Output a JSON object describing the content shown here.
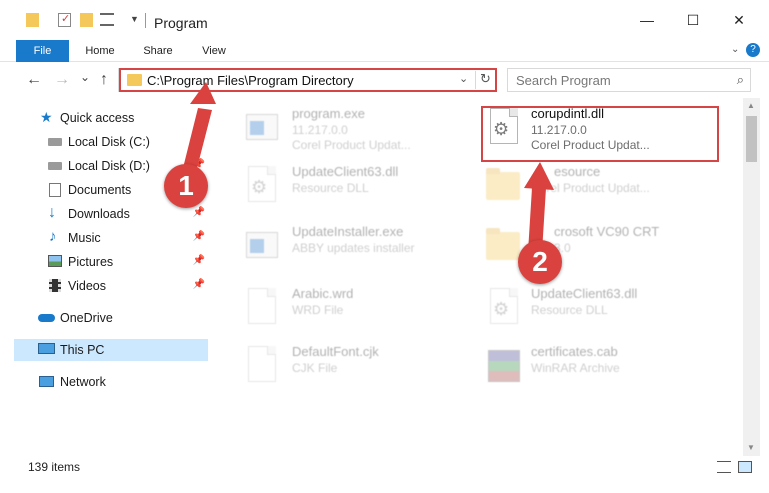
{
  "window": {
    "title": "Program",
    "minimize_glyph": "—",
    "maximize_glyph": "☐",
    "close_glyph": "✕"
  },
  "ribbon": {
    "tabs": [
      "File",
      "Home",
      "Share",
      "View"
    ],
    "help_glyph": "?"
  },
  "address": {
    "path": "C:\\Program Files\\Program Directory",
    "back_glyph": "←",
    "forward_glyph": "→",
    "recent_glyph": "⌄",
    "up_glyph": "↑",
    "dropdown_glyph": "⌄",
    "refresh_glyph": "↻"
  },
  "search": {
    "placeholder": "Search Program",
    "icon_glyph": "⌕"
  },
  "sidebar": {
    "items": [
      {
        "label": "Quick access",
        "icon": "star-icon"
      },
      {
        "label": "Local Disk (C:)",
        "icon": "drive-icon"
      },
      {
        "label": "Local Disk (D:)",
        "icon": "drive-icon"
      },
      {
        "label": "Documents",
        "icon": "documents-icon"
      },
      {
        "label": "Downloads",
        "icon": "download-icon"
      },
      {
        "label": "Music",
        "icon": "music-icon"
      },
      {
        "label": "Pictures",
        "icon": "pictures-icon"
      },
      {
        "label": "Videos",
        "icon": "videos-icon"
      },
      {
        "label": "OneDrive",
        "icon": "cloud-icon"
      },
      {
        "label": "This PC",
        "icon": "computer-icon"
      },
      {
        "label": "Network",
        "icon": "network-icon"
      }
    ]
  },
  "files": [
    {
      "name": "program.exe",
      "line1": "11.217.0.0",
      "line2": "Corel Product Updat...",
      "icon": "exe-icon"
    },
    {
      "name": "corupdintl.dll",
      "line1": "11.217.0.0",
      "line2": "Corel Product Updat...",
      "icon": "dll-icon"
    },
    {
      "name": "UpdateClient63.dll",
      "line1": "Resource DLL",
      "line2": "",
      "icon": "dll-icon"
    },
    {
      "name": "esource",
      "line1": "Corel Product Updat...",
      "line2": "",
      "icon": "folder-icon"
    },
    {
      "name": "UpdateInstaller.exe",
      "line1": "ABBY updates installer",
      "line2": "",
      "icon": "installer-icon"
    },
    {
      "name": "crosoft VC90 CRT",
      "line1": "3.0",
      "line2": "",
      "icon": "folder-icon"
    },
    {
      "name": "Arabic.wrd",
      "line1": "WRD File",
      "line2": "",
      "icon": "file-icon"
    },
    {
      "name": "UpdateClient63.dll",
      "line1": "Resource DLL",
      "line2": "",
      "icon": "dll-icon"
    },
    {
      "name": "DefaultFont.cjk",
      "line1": "CJK File",
      "line2": "",
      "icon": "file-icon"
    },
    {
      "name": "certificates.cab",
      "line1": "WinRAR Archive",
      "line2": "",
      "icon": "archive-icon"
    }
  ],
  "annotations": {
    "step1": "1",
    "step2": "2"
  },
  "status": {
    "items_count": "139 items"
  },
  "colors": {
    "accent": "#1979ca",
    "highlight": "#d64545",
    "badge": "#d9423e",
    "selected": "#cce8ff"
  }
}
